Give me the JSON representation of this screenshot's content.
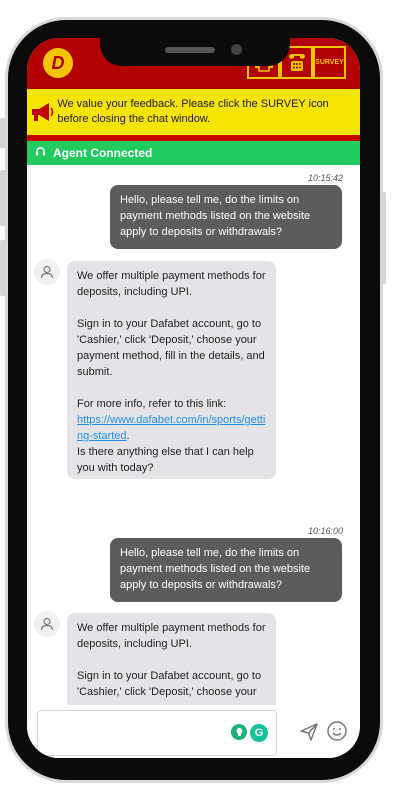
{
  "topbar": {
    "logo_glyph": "D",
    "icons": [
      "print-icon",
      "phone-icon",
      "survey-icon"
    ],
    "survey_label": "SURVEY"
  },
  "banner": {
    "text": "We value your feedback. Please click the SURVEY icon before closing the chat window."
  },
  "agent": {
    "status": "Agent Connected"
  },
  "messages": [
    {
      "type": "timestamp",
      "text": "10:15:42"
    },
    {
      "type": "outgoing",
      "text": "Hello, please tell me, do the limits on payment methods listed on the website apply to deposits or withdrawals?"
    },
    {
      "type": "incoming",
      "p1": "We offer multiple payment methods for deposits, including UPI.",
      "p2": "Sign in to your Dafabet account, go to 'Cashier,' click 'Deposit,' choose your payment method, fill in the details, and submit.",
      "p3": "For more info, refer to this link:",
      "link": "https://www.dafabet.com/in/sports/getting-started",
      "link_suffix": ".",
      "p4": "Is there anything else that I can help you with today?"
    },
    {
      "type": "timestamp",
      "text": "10:16:00"
    },
    {
      "type": "outgoing",
      "text": "Hello, please tell me, do the limits on payment methods listed on the website apply to deposits or withdrawals?"
    },
    {
      "type": "incoming",
      "p1": "We offer multiple payment methods for deposits, including UPI.",
      "p2": "Sign in to your Dafabet account, go to 'Cashier,' click 'Deposit,' choose your"
    }
  ],
  "composer": {
    "placeholder": "",
    "grammarly_letter": "G",
    "icons": [
      "grammarly-bulb-icon",
      "grammarly-icon",
      "send-icon",
      "emoji-icon"
    ]
  },
  "colors": {
    "topbar": "#b20000",
    "banner": "#f7e400",
    "agent_bar": "#21cb5f",
    "outgoing_bubble": "#5c5c5c",
    "incoming_bubble": "#e4e4e8",
    "link": "#1f8fe6"
  }
}
